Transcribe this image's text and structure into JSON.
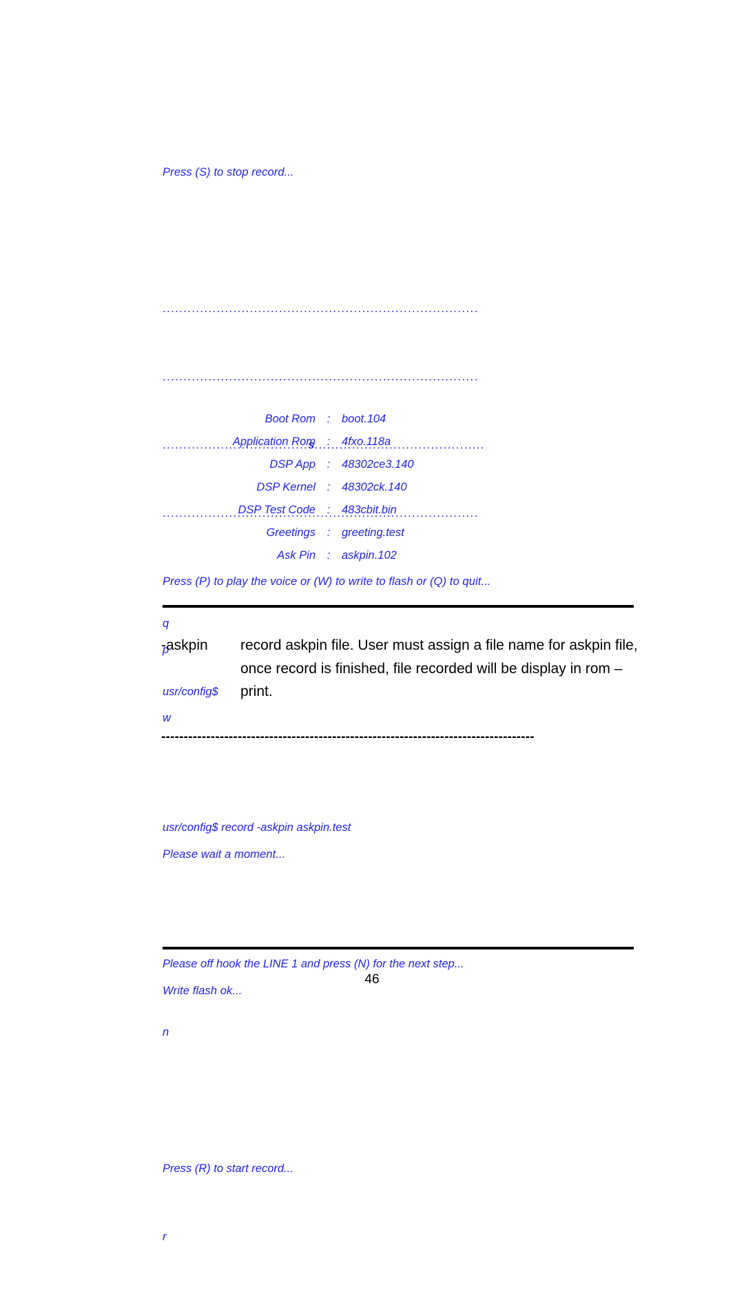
{
  "page": {
    "number": "46",
    "text_color_terminal": "#2020f0",
    "text_color_body": "#000000",
    "background": "#ffffff"
  },
  "terminal_top": {
    "lines": [
      "Press (S) to stop record...",
      "",
      "dots1",
      "dots2",
      "dots3",
      "dots4",
      "Press (P) to play the voice or (W) to write to flash or (Q) to quit...",
      "p",
      "w",
      "",
      "Please wait a moment...",
      "",
      "Write flash ok..."
    ],
    "line_press_stop": "Press (S) to stop record...",
    "dotted_line_1": "............................................................................",
    "dotted_line_2": "............................................................................",
    "dotted_line_3a": "...................................",
    "dotted_line_3_key": "s",
    "dotted_line_3b": ".........................................",
    "dotted_line_4": "............................................................................",
    "line_press_play": "Press (P) to play the voice or (W) to write to flash or (Q) to quit...",
    "key_p": "p",
    "key_w": "w",
    "line_please_wait": "Please wait a moment...",
    "line_write_flash_ok": "Write flash ok..."
  },
  "rom_versions": {
    "separator": ":",
    "rows": [
      {
        "label": "Boot Rom",
        "value": "boot.104"
      },
      {
        "label": "Application Rom",
        "value": "4fxo.118a"
      },
      {
        "label": "DSP App",
        "value": "48302ce3.140"
      },
      {
        "label": "DSP Kernel",
        "value": "48302ck.140"
      },
      {
        "label": "DSP Test Code",
        "value": "483cbit.bin"
      },
      {
        "label": "Greetings",
        "value": "greeting.test"
      },
      {
        "label": "Ask Pin",
        "value": "askpin.102"
      }
    ]
  },
  "terminal_after_rom": {
    "key_q": "q",
    "prompt": "usr/config$"
  },
  "description": {
    "command": "-askpin",
    "text": "record askpin file. User must assign a file name for askpin file, once record is finished, file recorded will be display in rom –print."
  },
  "dashed_separator": "-----------------------------------------------------------------------------------",
  "terminal_bottom": {
    "command_line": "usr/config$ record -askpin askpin.test",
    "line_off_hook": "Please off hook the LINE 1 and press (N) for the next step...",
    "key_n": "n",
    "line_press_start": "Press (R) to start record...",
    "key_r": "r"
  }
}
